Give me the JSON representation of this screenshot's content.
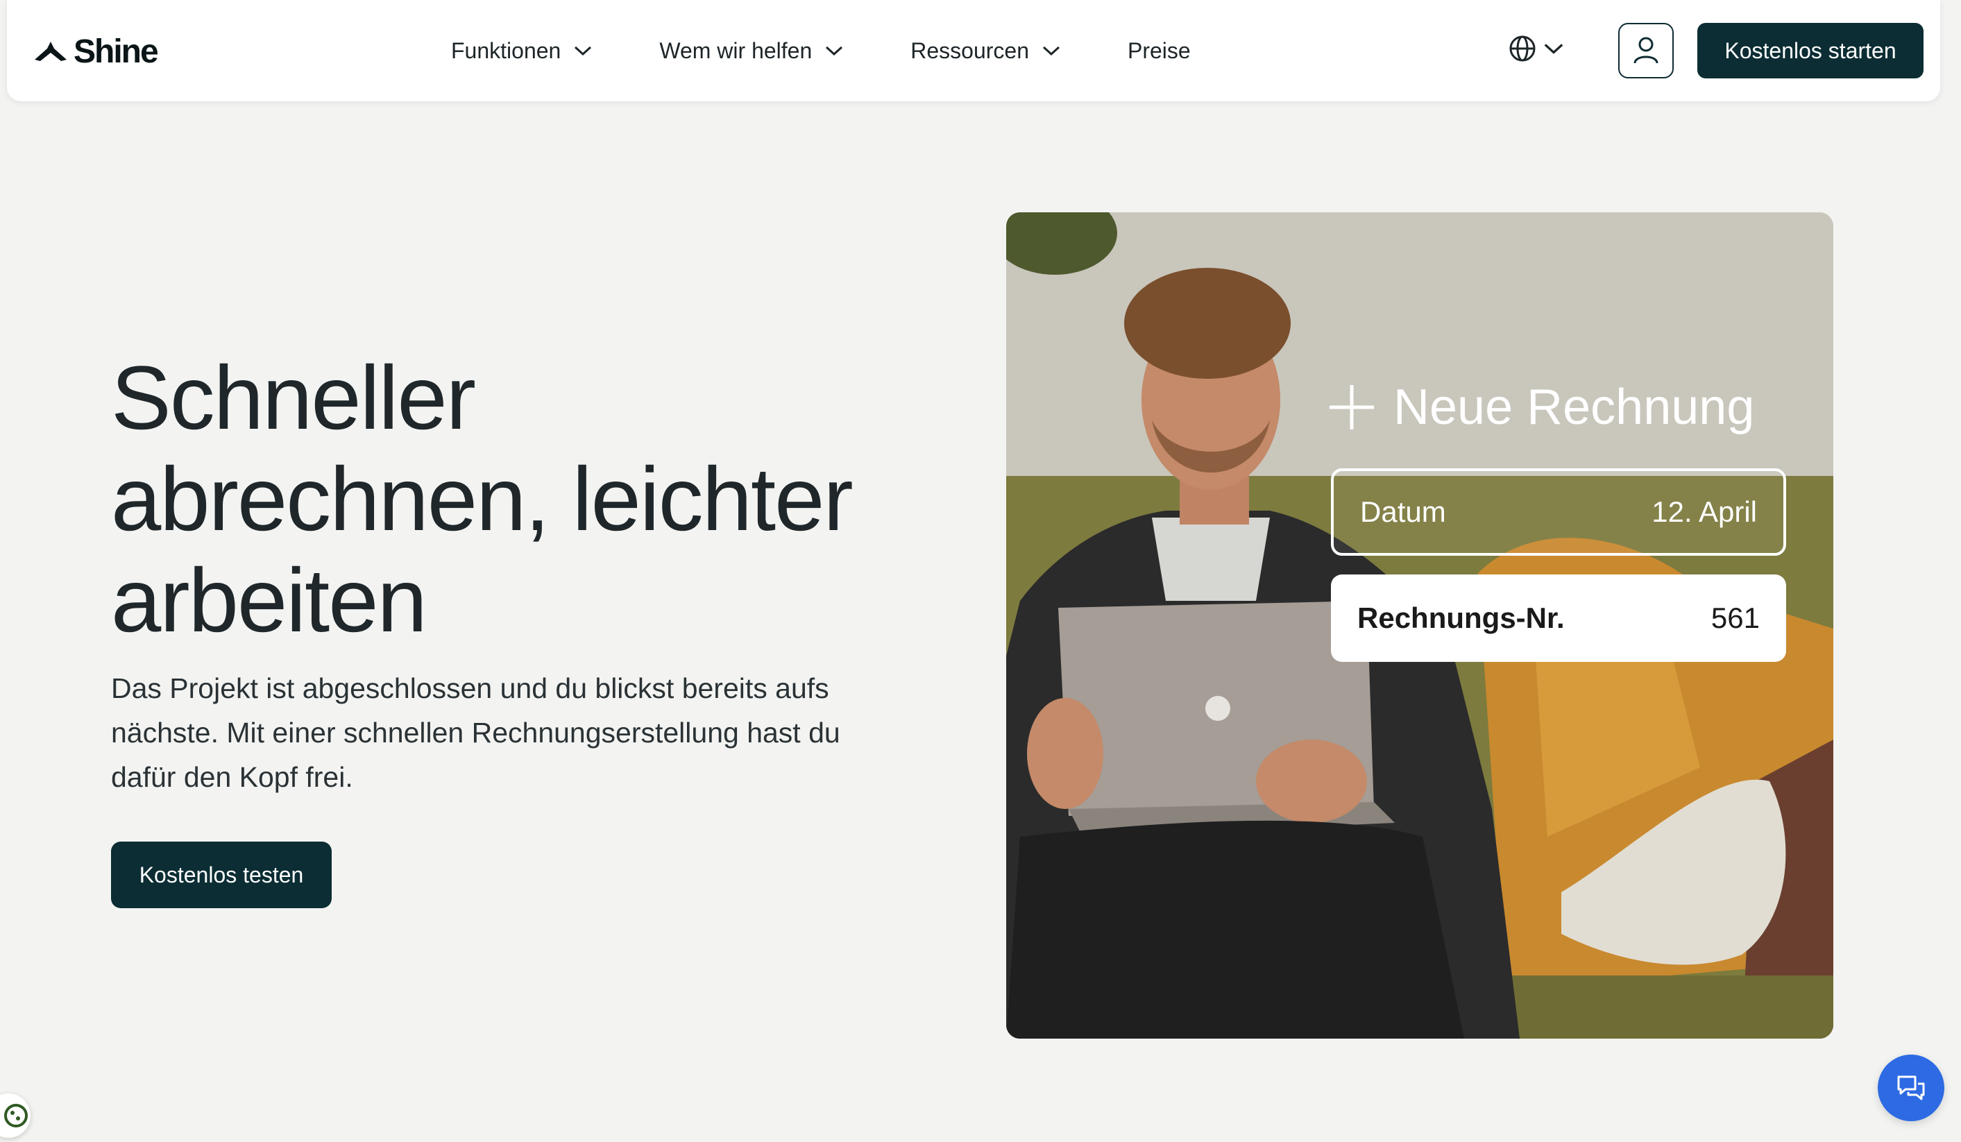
{
  "brand": {
    "name": "Shine"
  },
  "nav": {
    "items": [
      {
        "label": "Funktionen",
        "has_dropdown": true
      },
      {
        "label": "Wem wir helfen",
        "has_dropdown": true
      },
      {
        "label": "Ressourcen",
        "has_dropdown": true
      },
      {
        "label": "Preise",
        "has_dropdown": false
      }
    ],
    "language_icon": "globe-icon",
    "account_icon": "user-icon",
    "cta_label": "Kostenlos starten"
  },
  "hero": {
    "title_lines": [
      "Schneller",
      "abrechnen, leichter",
      "arbeiten"
    ],
    "description": "Das Projekt ist abgeschlossen und du blickst bereits aufs nächste. Mit einer schnellen Rechnungserstellung hast du dafür den Kopf frei.",
    "cta_label": "Kostenlos testen"
  },
  "hero_image": {
    "overlay_title": "Neue Rechnung",
    "fields": [
      {
        "label": "Datum",
        "value": "12. April"
      },
      {
        "label": "Rechnungs-Nr.",
        "value": "561"
      }
    ]
  },
  "widgets": {
    "chat_icon": "chat-icon",
    "cookie_icon": "cookie-icon"
  },
  "colors": {
    "primary": "#0b2d33",
    "background": "#f3f4f2",
    "chat": "#2d6ae3"
  }
}
